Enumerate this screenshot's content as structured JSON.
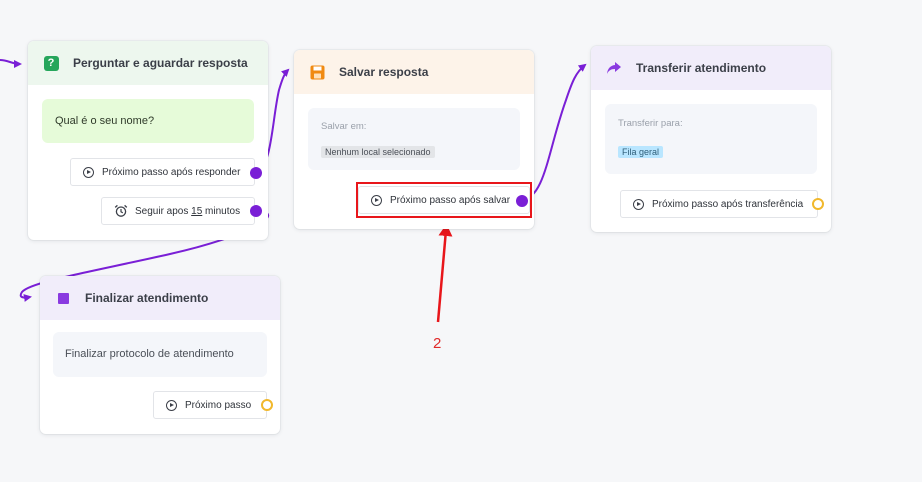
{
  "nodes": {
    "ask": {
      "title": "Perguntar e aguardar resposta",
      "message": "Qual é o seu nome?",
      "next_after_reply": "Próximo passo após responder",
      "timeout_prefix": "Seguir apos ",
      "timeout_value": "15",
      "timeout_suffix": " minutos",
      "icon": "question-icon",
      "accent": "#26a65b"
    },
    "save": {
      "title": "Salvar resposta",
      "save_in_label": "Salvar em:",
      "save_in_value": "Nenhum local selecionado",
      "next_label": "Próximo passo após salvar",
      "icon": "floppy-disk-icon",
      "accent": "#f08a12"
    },
    "transfer": {
      "title": "Transferir atendimento",
      "transfer_to_label": "Transferir para:",
      "transfer_to_value": "Fila geral",
      "next_label": "Próximo passo após transferência",
      "icon": "share-arrow-icon",
      "accent": "#8a3ae0"
    },
    "finish": {
      "title": "Finalizar atendimento",
      "message": "Finalizar protocolo de atendimento",
      "next_label": "Próximo passo",
      "icon": "square-stop-icon",
      "accent": "#8a3ae0"
    }
  },
  "colors": {
    "connector": "#7a1fd6",
    "open_port": "#f1b82c",
    "highlight": "#e8161b"
  },
  "annotation": {
    "label": "2"
  }
}
